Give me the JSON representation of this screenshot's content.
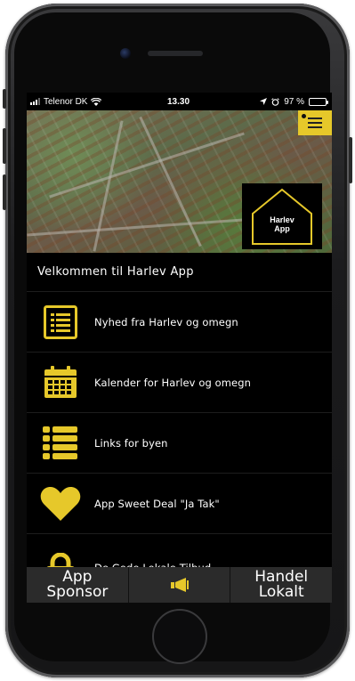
{
  "status_bar": {
    "carrier": "Telenor DK",
    "time": "13.30",
    "battery": "97 %",
    "battery_level": 0.97
  },
  "header": {
    "logo_line1": "Harlev",
    "logo_line2": "App",
    "menu_icon": "hamburger-menu-icon"
  },
  "welcome_text": "Velkommen til Harlev App",
  "menu": {
    "items": [
      {
        "label": "Nyhed fra Harlev og omegn",
        "icon": "news-list-icon"
      },
      {
        "label": "Kalender for Harlev og omegn",
        "icon": "calendar-icon"
      },
      {
        "label": "Links for byen",
        "icon": "list-links-icon"
      },
      {
        "label": "App Sweet Deal \"Ja Tak\"",
        "icon": "heart-icon"
      },
      {
        "label": "De Gode Lokale Tilbud",
        "icon": "lock-icon"
      }
    ]
  },
  "bottom_bar": {
    "left_line1": "App",
    "left_line2": "Sponsor",
    "center_icon": "megaphone-icon",
    "right_line1": "Handel",
    "right_line2": "Lokalt"
  },
  "colors": {
    "accent": "#e6c82a",
    "background": "#000000",
    "bottom_bar": "#2b2b2b"
  }
}
